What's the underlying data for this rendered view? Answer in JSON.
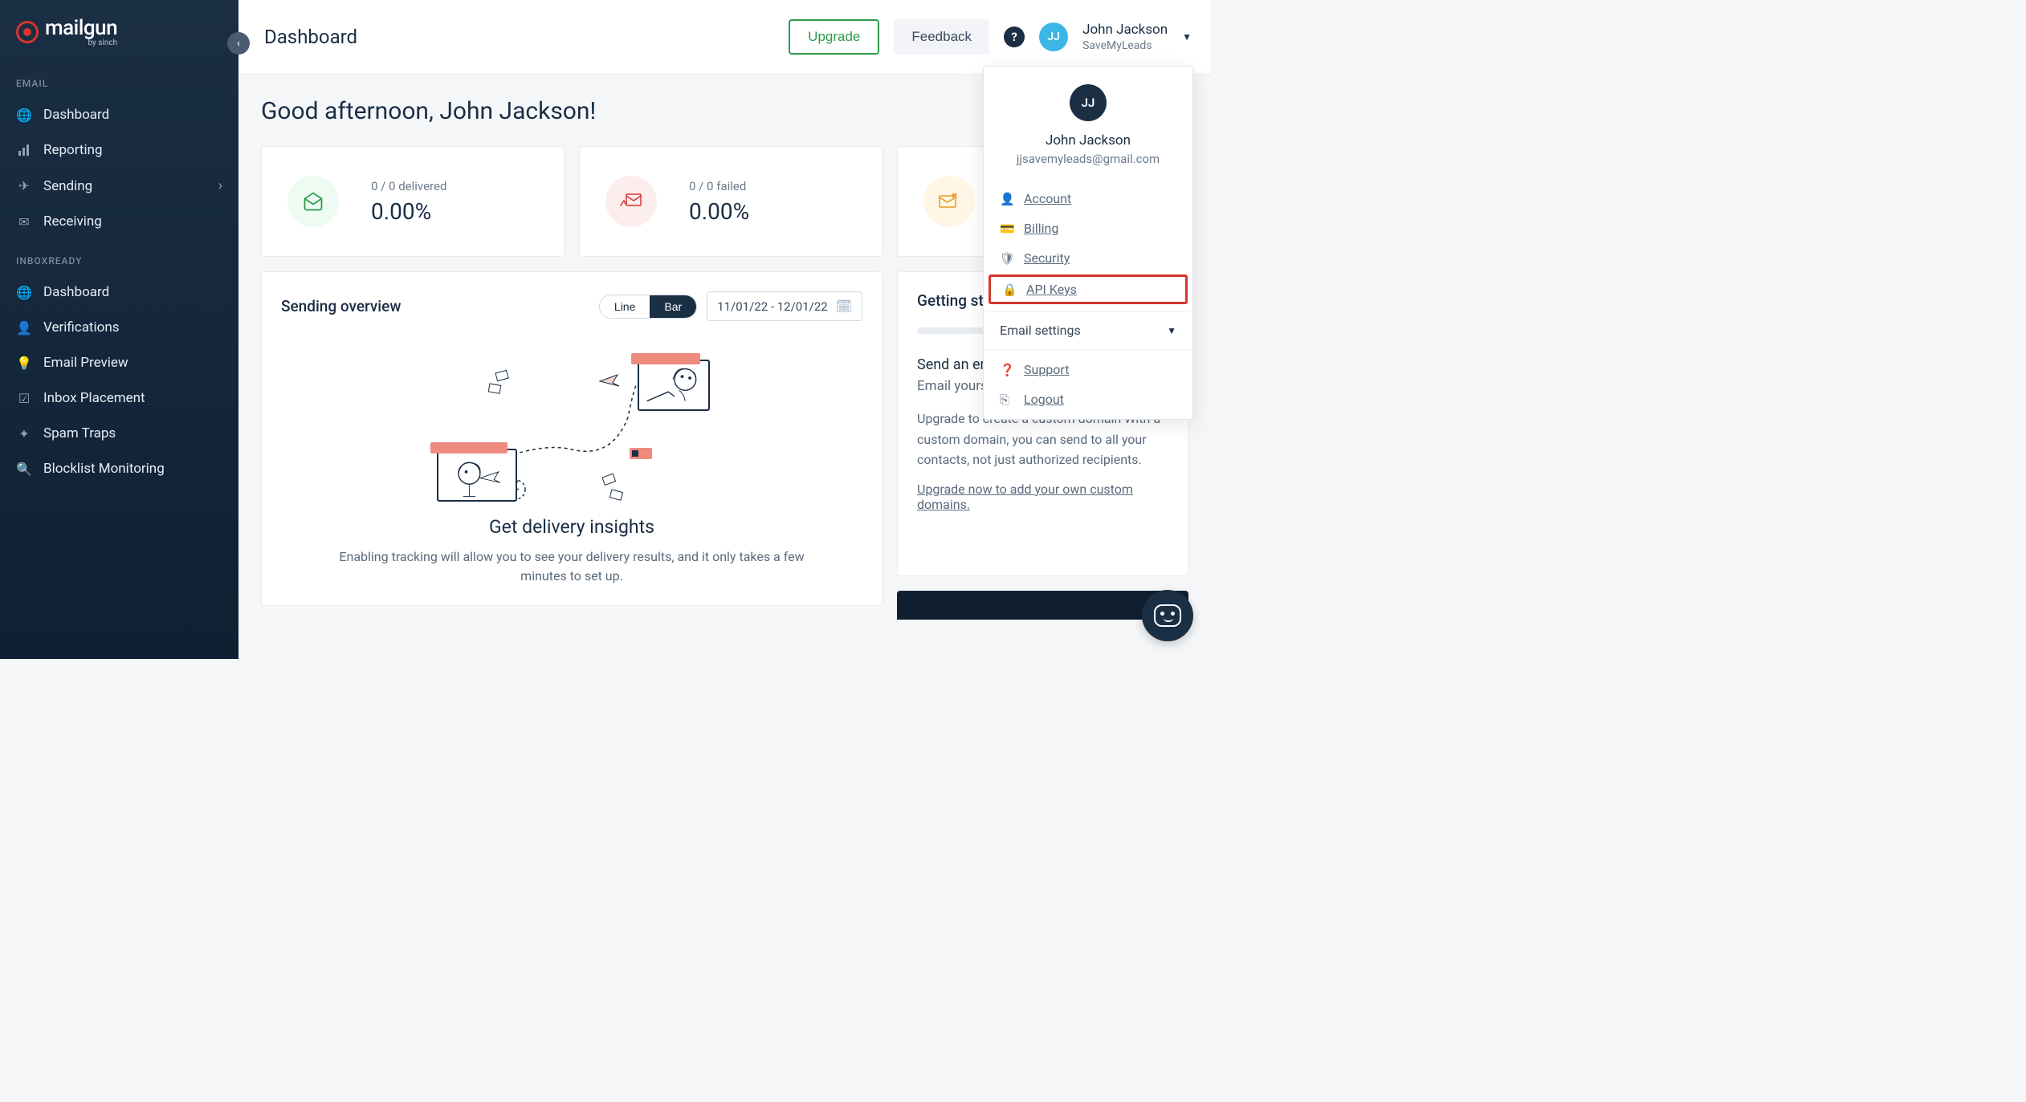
{
  "brand": {
    "name": "mailgun",
    "sub": "by sinch",
    "initials": "JJ"
  },
  "sidebar": {
    "sections": [
      {
        "label": "EMAIL",
        "items": [
          {
            "label": "Dashboard",
            "icon": "globe"
          },
          {
            "label": "Reporting",
            "icon": "bars"
          },
          {
            "label": "Sending",
            "icon": "plane",
            "expandable": true
          },
          {
            "label": "Receiving",
            "icon": "inbox"
          }
        ]
      },
      {
        "label": "INBOXREADY",
        "items": [
          {
            "label": "Dashboard",
            "icon": "globe"
          },
          {
            "label": "Verifications",
            "icon": "userplus"
          },
          {
            "label": "Email Preview",
            "icon": "bulb"
          },
          {
            "label": "Inbox Placement",
            "icon": "checkbox"
          },
          {
            "label": "Spam Traps",
            "icon": "nodes"
          },
          {
            "label": "Blocklist Monitoring",
            "icon": "search"
          }
        ]
      }
    ]
  },
  "header": {
    "title": "Dashboard",
    "upgrade": "Upgrade",
    "feedback": "Feedback",
    "user": {
      "name": "John Jackson",
      "org": "SaveMyLeads",
      "avatar": "JJ"
    }
  },
  "greeting": "Good afternoon, John Jackson!",
  "stats": {
    "delivered": {
      "label": "0 / 0 delivered",
      "value": "0.00%"
    },
    "failed": {
      "label": "0 / 0 failed",
      "value": "0.00%"
    }
  },
  "overview": {
    "title": "Sending overview",
    "line": "Line",
    "bar": "Bar",
    "date_range": "11/01/22 - 12/01/22",
    "chart_title": "Get delivery insights",
    "chart_desc": "Enabling tracking will allow you to see your delivery results, and it only takes a few minutes to set up."
  },
  "getting_started": {
    "title": "Getting started",
    "sub1": "Send an email",
    "sub2": "Email yourself",
    "body": "Upgrade to create a custom domain With a custom domain, you can send to all your contacts, not just authorized recipients.",
    "link": "Upgrade now to add your own custom domains."
  },
  "dropdown": {
    "name": "John Jackson",
    "email": "jjsavemyleads@gmail.com",
    "avatar": "JJ",
    "items": [
      {
        "label": "Account",
        "icon": "person"
      },
      {
        "label": "Billing",
        "icon": "card"
      },
      {
        "label": "Security",
        "icon": "shield"
      },
      {
        "label": "API Keys",
        "icon": "lock",
        "highlight": true
      }
    ],
    "expand": "Email settings",
    "support": "Support",
    "logout": "Logout"
  }
}
